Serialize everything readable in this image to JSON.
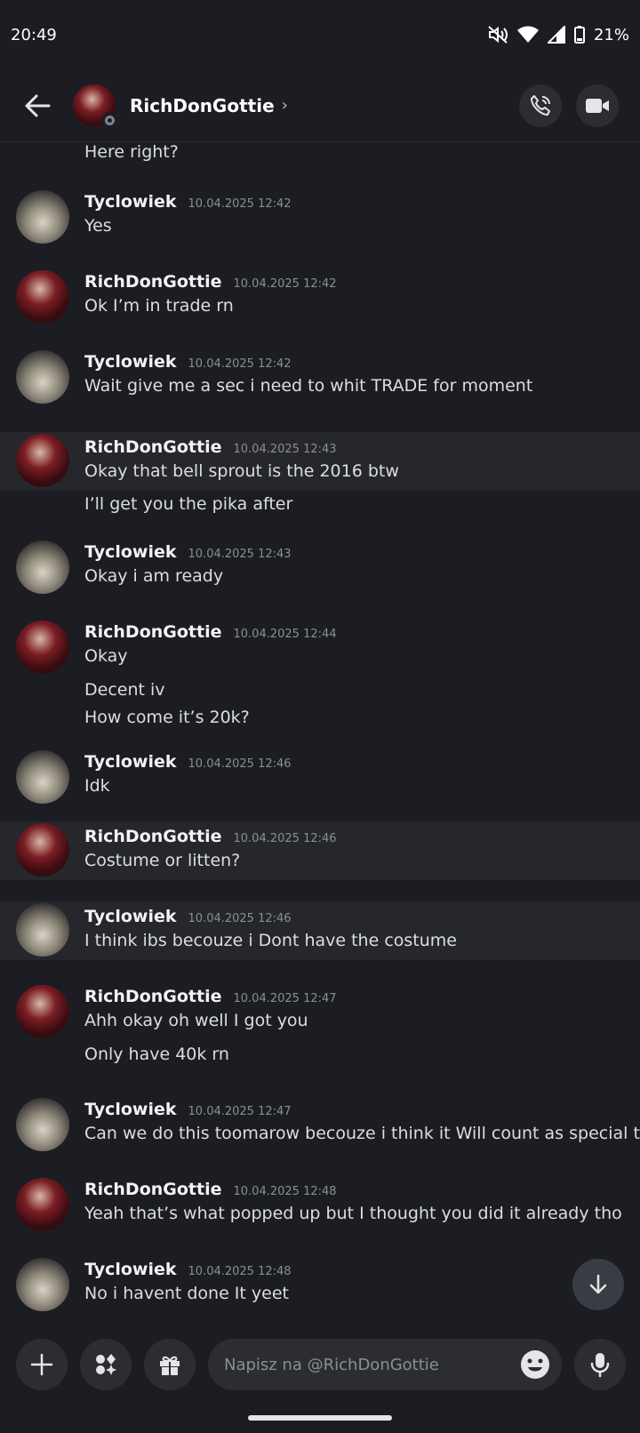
{
  "status_bar": {
    "time": "20:49",
    "battery": "21%"
  },
  "header": {
    "username": "RichDonGottie",
    "chevron": "›"
  },
  "messages": [
    {
      "id": 0,
      "lines": [
        "Here right?"
      ]
    },
    {
      "id": 1,
      "author": "Tyclowiek",
      "timestamp": "10.04.2025 12:42",
      "lines": [
        "Yes"
      ]
    },
    {
      "id": 2,
      "author": "RichDonGottie",
      "timestamp": "10.04.2025 12:42",
      "lines": [
        "Ok I’m in trade rn"
      ]
    },
    {
      "id": 3,
      "author": "Tyclowiek",
      "timestamp": "10.04.2025 12:42",
      "lines": [
        "Wait give me a sec i need to whit TRADE for moment"
      ]
    },
    {
      "id": 4,
      "author": "RichDonGottie",
      "timestamp": "10.04.2025 12:43",
      "lines": [
        "Okay that bell sprout is the 2016 btw",
        "I’ll get you the pika after"
      ]
    },
    {
      "id": 5,
      "author": "Tyclowiek",
      "timestamp": "10.04.2025 12:43",
      "lines": [
        "Okay i am ready"
      ]
    },
    {
      "id": 6,
      "author": "RichDonGottie",
      "timestamp": "10.04.2025 12:44",
      "lines": [
        "Okay",
        "Decent iv",
        "How come it’s 20k?"
      ]
    },
    {
      "id": 7,
      "author": "Tyclowiek",
      "timestamp": "10.04.2025 12:46",
      "lines": [
        "Idk"
      ]
    },
    {
      "id": 8,
      "author": "RichDonGottie",
      "timestamp": "10.04.2025 12:46",
      "lines": [
        "Costume or litten?"
      ]
    },
    {
      "id": 9,
      "author": "Tyclowiek",
      "timestamp": "10.04.2025 12:46",
      "lines": [
        "I think ibs becouze i Dont have the costume"
      ]
    },
    {
      "id": 10,
      "author": "RichDonGottie",
      "timestamp": "10.04.2025 12:47",
      "lines": [
        "Ahh okay oh well I got you",
        "Only have 40k rn"
      ]
    },
    {
      "id": 11,
      "author": "Tyclowiek",
      "timestamp": "10.04.2025 12:47",
      "lines": [
        "Can we do this toomarow becouze i think it Will count as special trade"
      ]
    },
    {
      "id": 12,
      "author": "RichDonGottie",
      "timestamp": "10.04.2025 12:48",
      "lines": [
        "Yeah that’s what popped up but I thought you did it already tho"
      ]
    },
    {
      "id": 13,
      "author": "Tyclowiek",
      "timestamp": "10.04.2025 12:48",
      "lines": [
        "No i havent done It yeet"
      ]
    }
  ],
  "composer": {
    "placeholder": "Napisz na @RichDonGottie"
  },
  "colors": {
    "background": "#1c1d22",
    "highlight": "#26272c",
    "button": "#2b2d31"
  }
}
